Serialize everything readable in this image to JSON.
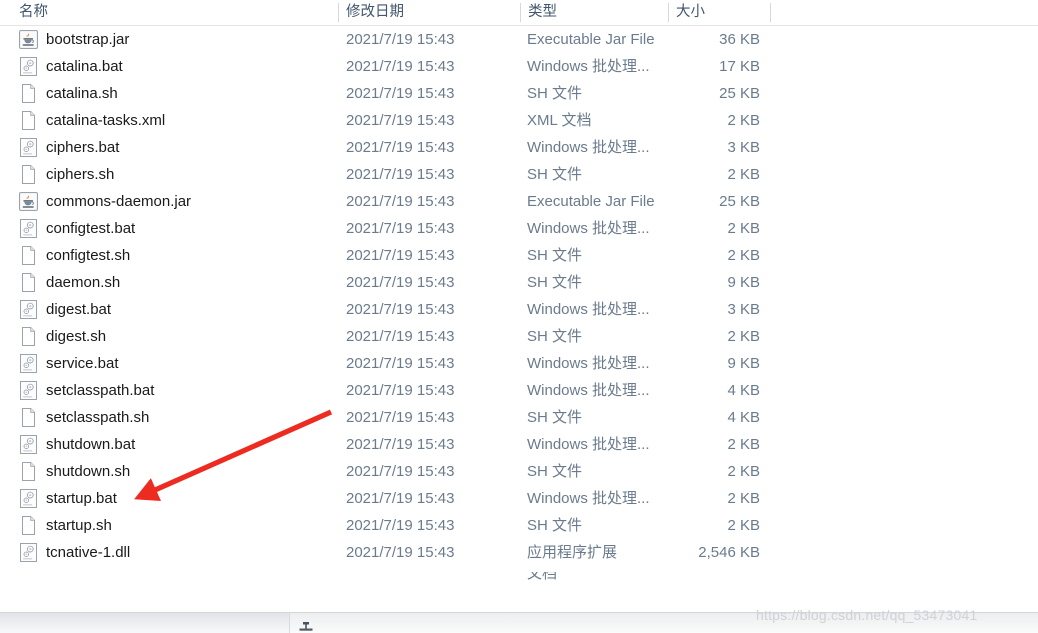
{
  "window": {
    "app": "Windows File Explorer",
    "watermark": "https://blog.csdn.net/qq_53473041"
  },
  "columns": {
    "name": "名称",
    "date_modified": "修改日期",
    "type": "类型",
    "size": "大小"
  },
  "annotation": {
    "arrow_color": "#ee2b20",
    "points_to": "startup.bat"
  },
  "types": {
    "jar": "Executable Jar File",
    "bat": "Windows 批处理...",
    "sh": "SH 文件",
    "xml": "XML 文档",
    "dll": "应用程序扩展"
  },
  "files": [
    {
      "name": "bootstrap.jar",
      "date": "2021/7/19 15:43",
      "type": "Executable Jar File",
      "size": "36 KB",
      "icon": "java-jar-icon"
    },
    {
      "name": "catalina.bat",
      "date": "2021/7/19 15:43",
      "type": "Windows 批处理...",
      "size": "17 KB",
      "icon": "batch-file-icon"
    },
    {
      "name": "catalina.sh",
      "date": "2021/7/19 15:43",
      "type": "SH 文件",
      "size": "25 KB",
      "icon": "generic-file-icon"
    },
    {
      "name": "catalina-tasks.xml",
      "date": "2021/7/19 15:43",
      "type": "XML 文档",
      "size": "2 KB",
      "icon": "generic-file-icon"
    },
    {
      "name": "ciphers.bat",
      "date": "2021/7/19 15:43",
      "type": "Windows 批处理...",
      "size": "3 KB",
      "icon": "batch-file-icon"
    },
    {
      "name": "ciphers.sh",
      "date": "2021/7/19 15:43",
      "type": "SH 文件",
      "size": "2 KB",
      "icon": "generic-file-icon"
    },
    {
      "name": "commons-daemon.jar",
      "date": "2021/7/19 15:43",
      "type": "Executable Jar File",
      "size": "25 KB",
      "icon": "java-jar-icon"
    },
    {
      "name": "configtest.bat",
      "date": "2021/7/19 15:43",
      "type": "Windows 批处理...",
      "size": "2 KB",
      "icon": "batch-file-icon"
    },
    {
      "name": "configtest.sh",
      "date": "2021/7/19 15:43",
      "type": "SH 文件",
      "size": "2 KB",
      "icon": "generic-file-icon"
    },
    {
      "name": "daemon.sh",
      "date": "2021/7/19 15:43",
      "type": "SH 文件",
      "size": "9 KB",
      "icon": "generic-file-icon"
    },
    {
      "name": "digest.bat",
      "date": "2021/7/19 15:43",
      "type": "Windows 批处理...",
      "size": "3 KB",
      "icon": "batch-file-icon"
    },
    {
      "name": "digest.sh",
      "date": "2021/7/19 15:43",
      "type": "SH 文件",
      "size": "2 KB",
      "icon": "generic-file-icon"
    },
    {
      "name": "service.bat",
      "date": "2021/7/19 15:43",
      "type": "Windows 批处理...",
      "size": "9 KB",
      "icon": "batch-file-icon"
    },
    {
      "name": "setclasspath.bat",
      "date": "2021/7/19 15:43",
      "type": "Windows 批处理...",
      "size": "4 KB",
      "icon": "batch-file-icon"
    },
    {
      "name": "setclasspath.sh",
      "date": "2021/7/19 15:43",
      "type": "SH 文件",
      "size": "4 KB",
      "icon": "generic-file-icon"
    },
    {
      "name": "shutdown.bat",
      "date": "2021/7/19 15:43",
      "type": "Windows 批处理...",
      "size": "2 KB",
      "icon": "batch-file-icon"
    },
    {
      "name": "shutdown.sh",
      "date": "2021/7/19 15:43",
      "type": "SH 文件",
      "size": "2 KB",
      "icon": "generic-file-icon"
    },
    {
      "name": "startup.bat",
      "date": "2021/7/19 15:43",
      "type": "Windows 批处理...",
      "size": "2 KB",
      "icon": "batch-file-icon"
    },
    {
      "name": "startup.sh",
      "date": "2021/7/19 15:43",
      "type": "SH 文件",
      "size": "2 KB",
      "icon": "generic-file-icon"
    },
    {
      "name": "tcnative-1.dll",
      "date": "2021/7/19 15:43",
      "type": "应用程序扩展",
      "size": "2,546 KB",
      "icon": "batch-file-icon"
    }
  ],
  "partial_row": {
    "type": "文档"
  }
}
